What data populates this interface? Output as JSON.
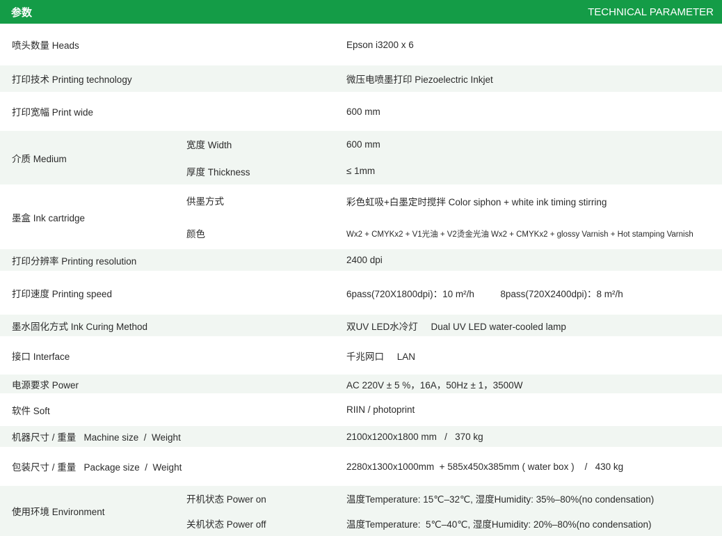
{
  "header": {
    "left": "参数",
    "right": "TECHNICAL PARAMETER"
  },
  "rows": [
    {
      "label": "喷头数量   Heads",
      "values": [
        "Epson i3200 x 6"
      ]
    },
    {
      "label": "打印技术   Printing technology",
      "values": [
        "微压电喷墨打印     Piezoelectric Inkjet"
      ]
    },
    {
      "label": "打印宽幅   Print wide",
      "values": [
        "600 mm"
      ]
    },
    {
      "label": "介质   Medium",
      "subs": [
        "宽度   Width",
        "厚度   Thickness"
      ],
      "values": [
        "600 mm",
        "≤ 1mm"
      ]
    },
    {
      "label": "墨盒   Ink cartridge",
      "subs": [
        "供墨方式",
        "颜色"
      ],
      "values": [
        "彩色虹吸+白墨定时搅拌   Color siphon + white ink timing stirring",
        "Wx2 + CMYKx2 + V1光油 + V2烫金光油 Wx2 + CMYKx2 + glossy Varnish + Hot stamping Varnish"
      ]
    },
    {
      "label": "打印分辨率   Printing resolution",
      "values": [
        "2400 dpi"
      ]
    },
    {
      "label": "打印速度   Printing speed",
      "values": [
        "6pass(720X1800dpi)：10 m²/h          8pass(720X2400dpi)：8 m²/h"
      ]
    },
    {
      "label": "墨水固化方式   Ink Curing Method",
      "values": [
        "双UV LED水冷灯     Dual UV LED water-cooled lamp"
      ]
    },
    {
      "label": "接口   Interface",
      "values": [
        "千兆网口     LAN"
      ]
    },
    {
      "label": "电源要求   Power",
      "values": [
        "AC 220V  ± 5 %，16A，50Hz  ± 1，3500W"
      ]
    },
    {
      "label": "软件   Soft",
      "values": [
        "RIIN / photoprint"
      ]
    },
    {
      "label": "机器尺寸 / 重量   Machine size  /  Weight",
      "values": [
        "2100x1200x1800 mm   /   370 kg"
      ]
    },
    {
      "label": "包装尺寸 / 重量   Package size  /  Weight",
      "values": [
        "2280x1300x1000mm  + 585x450x385mm ( water box )    /   430 kg"
      ]
    },
    {
      "label": "使用环境   Environment",
      "subs": [
        "开机状态  Power on",
        "关机状态  Power off"
      ],
      "values": [
        "温度Temperature: 15℃–32℃, 湿度Humidity: 35%–80%(no condensation)",
        "温度Temperature:  5℃–40℃, 湿度Humidity: 20%–80%(no condensation)"
      ]
    }
  ]
}
